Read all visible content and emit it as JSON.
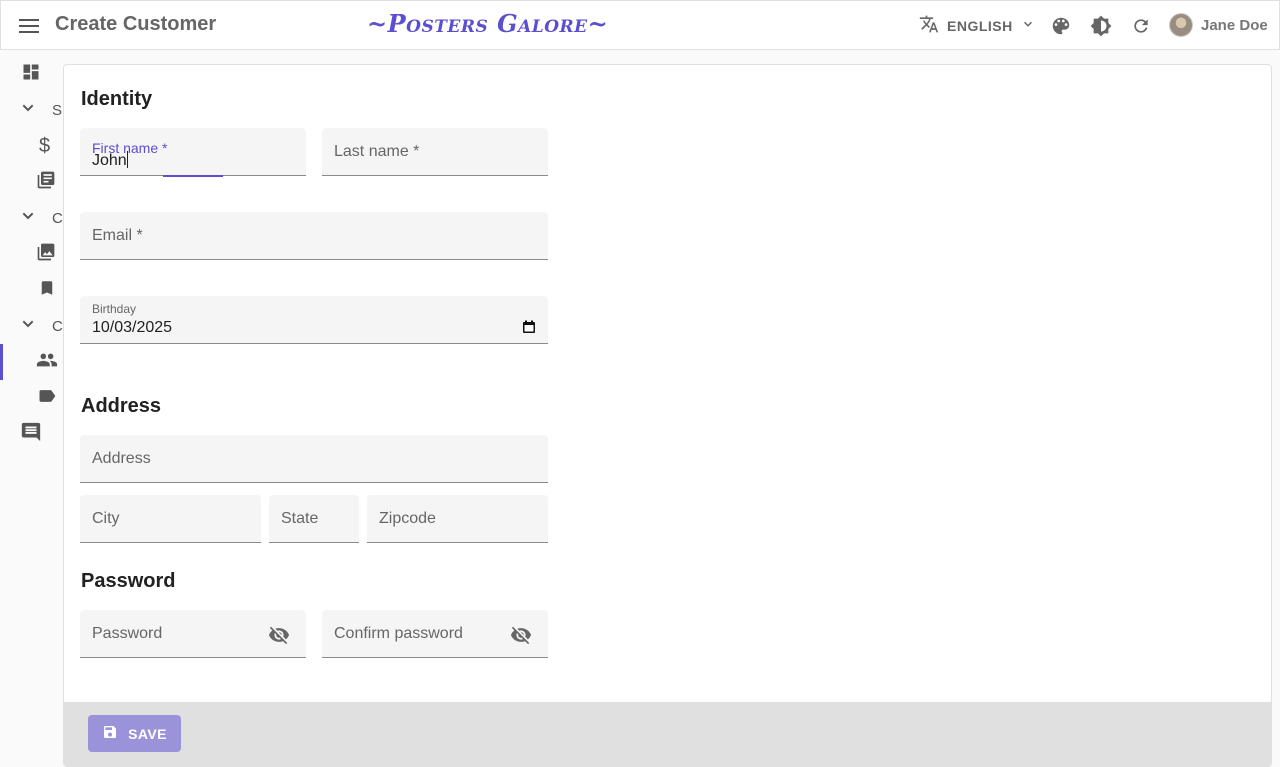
{
  "header": {
    "title": "Create Customer",
    "brand": "~Posters Galore~",
    "language": "ENGLISH",
    "user_name": "Jane Doe"
  },
  "sidebar": {
    "items": [
      {
        "icon": "dashboard-icon",
        "label": ""
      },
      {
        "icon": "chevron-down-icon",
        "label": "S"
      },
      {
        "icon": "dollar-icon",
        "label": ""
      },
      {
        "icon": "library-books-icon",
        "label": ""
      },
      {
        "icon": "chevron-down-icon",
        "label": "C"
      },
      {
        "icon": "photo-library-icon",
        "label": ""
      },
      {
        "icon": "bookmark-icon",
        "label": ""
      },
      {
        "icon": "chevron-down-icon",
        "label": "C"
      },
      {
        "icon": "people-icon",
        "label": ""
      },
      {
        "icon": "label-icon",
        "label": ""
      },
      {
        "icon": "comment-icon",
        "label": ""
      }
    ]
  },
  "form": {
    "identity_title": "Identity",
    "first_name_label": "First name *",
    "first_name_value": "John",
    "last_name_label": "Last name *",
    "email_label": "Email *",
    "birthday_label": "Birthday",
    "birthday_value": "10/03/2025",
    "address_title": "Address",
    "address_label": "Address",
    "city_label": "City",
    "state_label": "State",
    "zipcode_label": "Zipcode",
    "password_title": "Password",
    "password_label": "Password",
    "confirm_password_label": "Confirm password"
  },
  "toolbar": {
    "save_label": "SAVE"
  },
  "colors": {
    "accent": "#5b4fcf",
    "save_button": "#9b93d9"
  }
}
